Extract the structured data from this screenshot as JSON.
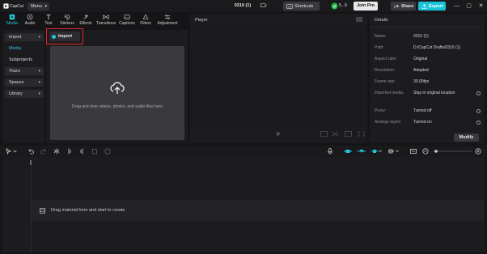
{
  "titlebar": {
    "app_name": "CapCut",
    "menu_label": "Menu",
    "project_title": "0310 (1)",
    "shortcuts_label": "Shortcuts",
    "pro_badge_label": "5...9",
    "join_pro_label": "Join Pro",
    "share_label": "Share",
    "export_label": "Export",
    "colors": {
      "accent": "#18c2d9",
      "badge_green": "#1fb94b"
    }
  },
  "toolbar": {
    "tools": [
      {
        "label": "Media",
        "icon": "media-icon"
      },
      {
        "label": "Audio",
        "icon": "audio-icon"
      },
      {
        "label": "Text",
        "icon": "text-icon"
      },
      {
        "label": "Stickers",
        "icon": "stickers-icon"
      },
      {
        "label": "Effects",
        "icon": "effects-icon"
      },
      {
        "label": "Transitions",
        "icon": "transitions-icon"
      },
      {
        "label": "Captions",
        "icon": "captions-icon"
      },
      {
        "label": "Filters",
        "icon": "filters-icon"
      },
      {
        "label": "Adjustment",
        "icon": "adjustment-icon"
      }
    ]
  },
  "sidebar": {
    "items": [
      {
        "label": "Import"
      },
      {
        "label": "Media"
      },
      {
        "label": "Subprojects"
      },
      {
        "label": "Yours"
      },
      {
        "label": "Spaces"
      },
      {
        "label": "Library"
      }
    ]
  },
  "media": {
    "import_label": "Import",
    "drop_text": "Drag and drop videos, photos, and audio files here"
  },
  "player": {
    "title": "Player"
  },
  "details": {
    "title": "Details",
    "rows": [
      {
        "key": "Name:",
        "value": "0310 (1)"
      },
      {
        "key": "Path:",
        "value": "D:/CapCut Drafts/0310 (1)"
      },
      {
        "key": "Aspect ratio:",
        "value": "Original"
      },
      {
        "key": "Resolution:",
        "value": "Adapted"
      },
      {
        "key": "Frame rate:",
        "value": "30.00fps"
      },
      {
        "key": "Imported media:",
        "value": "Stay in original location"
      },
      {
        "key": "Proxy:",
        "value": "Turned off"
      },
      {
        "key": "Arrange layers",
        "value": "Turned on"
      }
    ],
    "modify_label": "Modify"
  },
  "timeline": {
    "drag_text": "Drag material here and start to create"
  }
}
